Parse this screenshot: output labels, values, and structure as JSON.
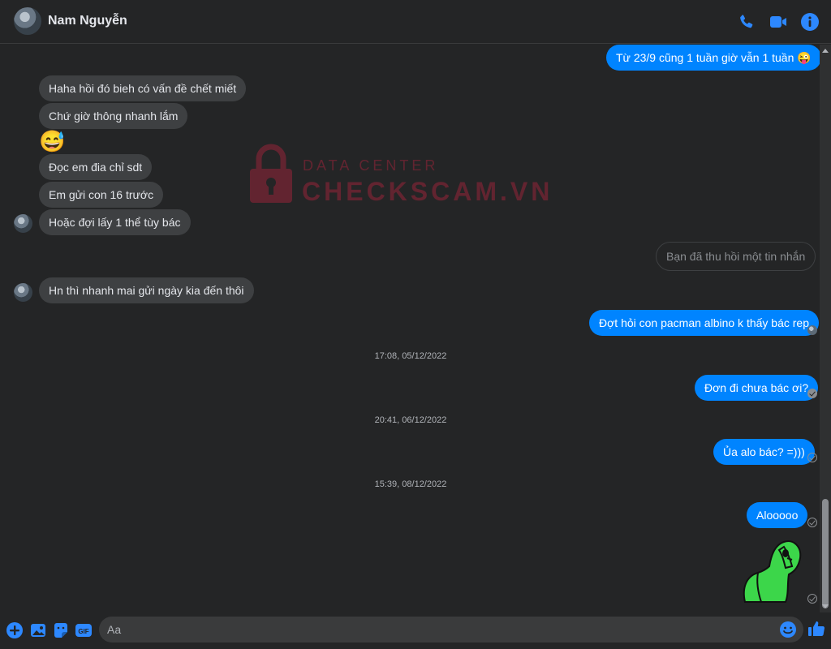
{
  "header": {
    "contact_name": "Nam Nguyễn",
    "icons": [
      "phone-icon",
      "video-icon",
      "info-icon"
    ]
  },
  "watermark": {
    "line1": "DATA CENTER",
    "line2": "CHECKSCAM.VN"
  },
  "messages": {
    "m1": "Từ 23/9 cũng 1 tuần giờ vẫn 1 tuần 😜",
    "m2": "Haha hồi đó bieh có vấn đề chết miết",
    "m3": "Chứ giờ thông nhanh lắm",
    "m4": "😅",
    "m5": "Đọc em đia chỉ sdt",
    "m6": "Em gửi con 16 trước",
    "m7": "Hoặc đợi lấy 1 thể tùy bác",
    "m8": "Bạn đã thu hồi một tin nhắn",
    "m9": "Hn thì nhanh mai gửi ngày kia đến thôi",
    "m10": "Đợt hỏi con pacman albino k thấy bác rep",
    "m11": "Đơn đi chưa bác ơi?",
    "m12": "Ủa alo bác? =)))",
    "m13": "Alooooo"
  },
  "timestamps": {
    "t1": "17:08, 05/12/2022",
    "t2": "20:41, 06/12/2022",
    "t3": "15:39, 08/12/2022"
  },
  "composer": {
    "placeholder": "Aa",
    "icons": [
      "plus-icon",
      "image-icon",
      "sticker-icon",
      "gif-icon",
      "emoji-icon",
      "thumbs-up-icon"
    ],
    "gif_label": "GIF"
  },
  "colors": {
    "accent": "#0084ff",
    "incoming_bubble": "#3e4042",
    "background": "#242526"
  }
}
